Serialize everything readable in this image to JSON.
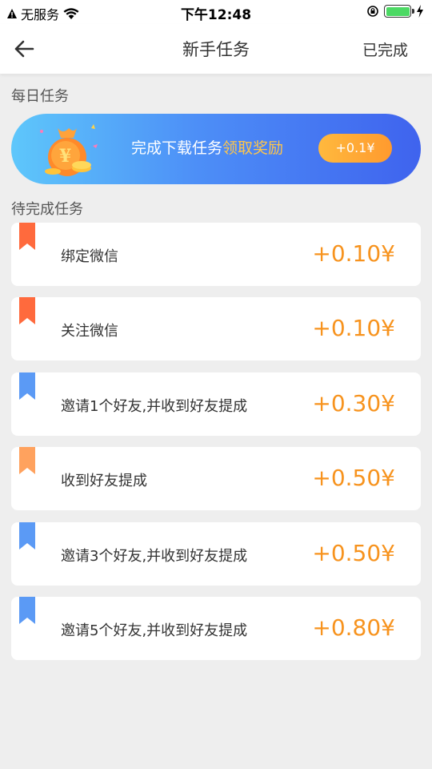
{
  "status_bar": {
    "carrier": "无服务",
    "time": "下午12:48"
  },
  "nav": {
    "title": "新手任务",
    "right_label": "已完成"
  },
  "daily": {
    "section_title": "每日任务",
    "banner_text": "完成下载任务",
    "banner_highlight": "领取奖励",
    "reward": "+0.1¥"
  },
  "pending": {
    "section_title": "待完成任务",
    "tasks": [
      {
        "label": "绑定微信",
        "reward": "+0.10¥",
        "ribbon_color": "#ff6a3d"
      },
      {
        "label": "关注微信",
        "reward": "+0.10¥",
        "ribbon_color": "#ff6a3d"
      },
      {
        "label": "邀请1个好友,并收到好友提成",
        "reward": "+0.30¥",
        "ribbon_color": "#5b9af5"
      },
      {
        "label": "收到好友提成",
        "reward": "+0.50¥",
        "ribbon_color": "#ffa25e"
      },
      {
        "label": "邀请3个好友,并收到好友提成",
        "reward": "+0.50¥",
        "ribbon_color": "#5b9af5"
      },
      {
        "label": "邀请5个好友,并收到好友提成",
        "reward": "+0.80¥",
        "ribbon_color": "#5b9af5"
      }
    ]
  },
  "colors": {
    "accent_orange": "#f7931e",
    "banner_highlight": "#ffc64a"
  }
}
